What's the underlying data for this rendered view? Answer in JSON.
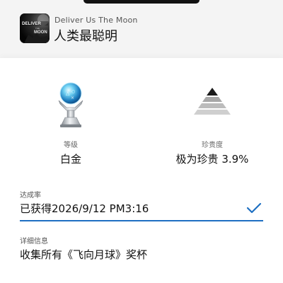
{
  "header": {
    "game_title": "Deliver Us The Moon",
    "trophy_name": "人类最聪明"
  },
  "stats": {
    "grade": {
      "label": "等级",
      "value": "白金",
      "icon": "platinum-trophy-icon"
    },
    "rarity": {
      "label": "珍贵度",
      "value": "极为珍贵 3.9%",
      "icon": "pyramid-rarity-icon"
    }
  },
  "achievement": {
    "label": "达成率",
    "value": "已获得2026/9/12  PM3:16",
    "icon": "checkmark-icon",
    "accent_color": "#1e6fc2"
  },
  "detail": {
    "label": "详细信息",
    "value": "收集所有《飞向月球》奖杯"
  }
}
